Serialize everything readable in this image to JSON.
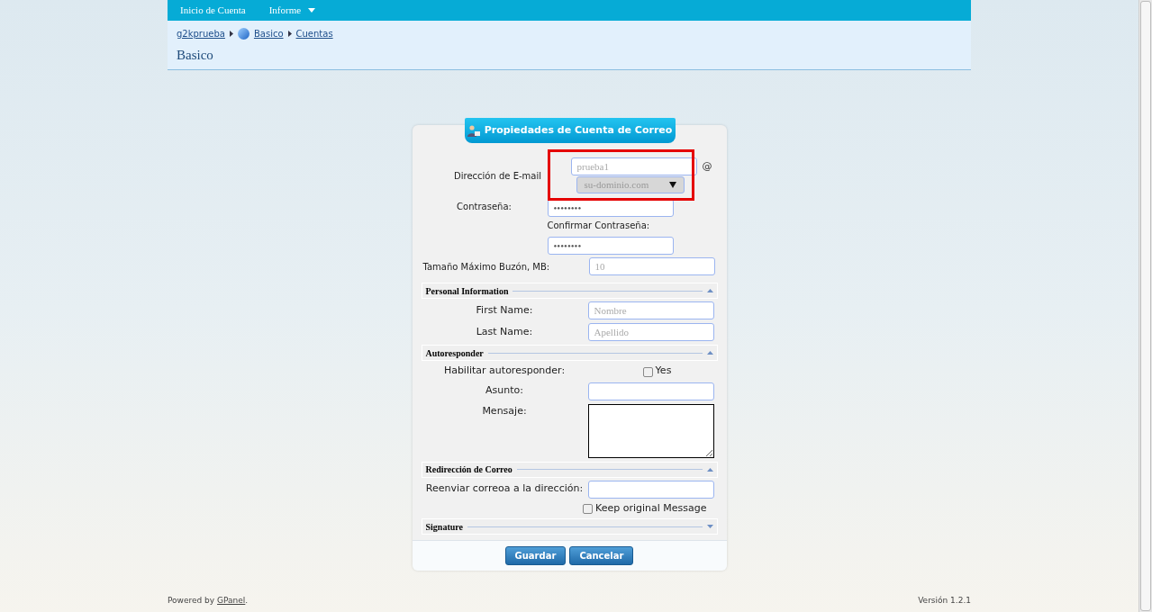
{
  "nav": [
    {
      "label": "Inicio de Cuenta",
      "dropdown": false
    },
    {
      "label": "Informe",
      "dropdown": true
    }
  ],
  "breadcrumbs": [
    {
      "label": "g2kprueba",
      "kind": "link"
    },
    {
      "label": "Basico",
      "kind": "module"
    },
    {
      "label": "Cuentas",
      "kind": "link"
    }
  ],
  "page_title": "Basico",
  "form": {
    "title": "Propiedades de Cuenta de Correo",
    "email": {
      "label": "Dirección de E-mail",
      "user_placeholder": "prueba1",
      "at": "@",
      "domain": "su-dominio.com",
      "highlighted": true
    },
    "password": {
      "label": "Contraseña:",
      "value": "••••••••"
    },
    "confirm": {
      "label": "Confirmar Contraseña:",
      "value": "••••••••"
    },
    "max_size": {
      "label": "Tamaño Máximo Buzón, MB:",
      "placeholder": "10"
    },
    "sections": [
      {
        "title": "Personal Information",
        "expanded": true,
        "fields": [
          {
            "kind": "text",
            "label": "First Name:",
            "placeholder": "Nombre"
          },
          {
            "kind": "text",
            "label": "Last Name:",
            "placeholder": "Apellido"
          }
        ]
      },
      {
        "title": "Autoresponder",
        "expanded": true,
        "fields": [
          {
            "kind": "checkbox",
            "label": "Habilitar autoresponder:",
            "option": "Yes",
            "checked": false
          },
          {
            "kind": "text",
            "label": "Asunto:"
          },
          {
            "kind": "textarea",
            "label": "Mensaje:"
          }
        ]
      },
      {
        "title": "Redirección de Correo",
        "expanded": true,
        "fields": [
          {
            "kind": "text",
            "label": "Reenviar correoa a la dirección:"
          },
          {
            "kind": "checkbox",
            "option": "Keep original Message",
            "checked": false
          }
        ]
      },
      {
        "title": "Signature",
        "expanded": false
      }
    ],
    "buttons": [
      "Guardar",
      "Cancelar"
    ]
  },
  "footer": {
    "prefix": "Powered by",
    "link": "GPanel",
    "suffix": ".",
    "version": "Versión 1.2.1"
  }
}
